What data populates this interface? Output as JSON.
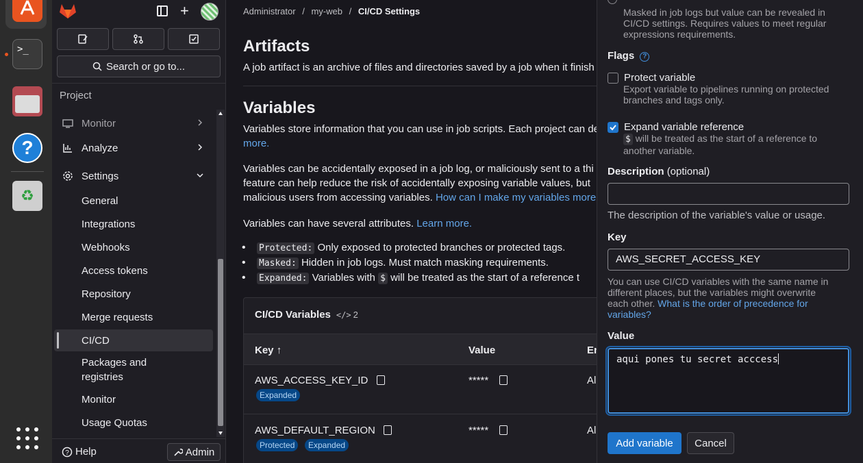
{
  "breadcrumb": {
    "items": [
      "Administrator",
      "my-web",
      "CI/CD Settings"
    ]
  },
  "sidebar": {
    "search_label": "Search or go to...",
    "section_label": "Project",
    "items": [
      {
        "label": "Monitor"
      },
      {
        "label": "Analyze"
      },
      {
        "label": "Settings"
      },
      {
        "label": "General"
      },
      {
        "label": "Integrations"
      },
      {
        "label": "Webhooks"
      },
      {
        "label": "Access tokens"
      },
      {
        "label": "Repository"
      },
      {
        "label": "Merge requests"
      },
      {
        "label": "CI/CD"
      },
      {
        "label": "Packages and"
      },
      {
        "label": "registries"
      },
      {
        "label": "Monitor"
      },
      {
        "label": "Usage Quotas"
      }
    ],
    "help_label": "Help",
    "admin_label": "Admin"
  },
  "main": {
    "artifacts_title": "Artifacts",
    "artifacts_desc": "A job artifact is an archive of files and directories saved by a job when it finish",
    "variables_title": "Variables",
    "vars_desc_1": "Variables store information that you can use in job scripts. Each project can de",
    "vars_desc_more": "more.",
    "exposed_1": "Variables can be accidentally exposed in a job log, or maliciously sent to a thi",
    "exposed_2": "feature can help reduce the risk of accidentally exposing variable values, but",
    "exposed_3": "malicious users from accessing variables.",
    "exposed_link": "How can I make my variables more",
    "attrs_text": "Variables can have several attributes.",
    "attrs_link": "Learn more.",
    "bullets": [
      {
        "code": "Protected:",
        "text": "Only exposed to protected branches or protected tags."
      },
      {
        "code": "Masked:",
        "text": "Hidden in job logs. Must match masking requirements."
      },
      {
        "code": "Expanded:",
        "text": "Variables with",
        "code2": "$",
        "text2": "will be treated as the start of a reference t"
      }
    ],
    "table": {
      "title": "CI/CD Variables",
      "count": "2",
      "headers": [
        "Key",
        "Value",
        "En"
      ],
      "rows": [
        {
          "key": "AWS_ACCESS_KEY_ID",
          "value": "*****",
          "env": "Al",
          "badges": [
            "Expanded"
          ]
        },
        {
          "key": "AWS_DEFAULT_REGION",
          "value": "*****",
          "env": "Al",
          "badges": [
            "Protected",
            "Expanded"
          ]
        }
      ]
    }
  },
  "panel": {
    "masked_desc_1": "Masked in job logs but value can be revealed in",
    "masked_desc_2": "CI/CD settings. Requires values to meet regular",
    "masked_desc_3": "expressions requirements.",
    "flags_label": "Flags",
    "protect_label": "Protect variable",
    "protect_checked": false,
    "protect_desc_1": "Export variable to pipelines running on protected",
    "protect_desc_2": "branches and tags only.",
    "expand_label": "Expand variable reference",
    "expand_checked": true,
    "expand_code": "$",
    "expand_desc_1": "will be treated as the start of a reference to",
    "expand_desc_2": "another variable.",
    "description_label": "Description",
    "description_optional": "(optional)",
    "description_value": "",
    "description_help": "The description of the variable's value or usage.",
    "key_label": "Key",
    "key_value": "AWS_SECRET_ACCESS_KEY",
    "key_help_1": "You can use CI/CD variables with the same name in",
    "key_help_2": "different places, but the variables might overwrite",
    "key_help_3": "each other.",
    "key_help_link_1": "What is the order of precedence for",
    "key_help_link_2": "variables?",
    "value_label": "Value",
    "value_text": "aqui pones tu secret acccess",
    "add_button": "Add variable",
    "cancel_button": "Cancel"
  },
  "colors": {
    "accent": "#1f75cb",
    "link": "#63a6e9",
    "badge_bg": "#064787",
    "ubuntu_orange": "#e95420"
  }
}
